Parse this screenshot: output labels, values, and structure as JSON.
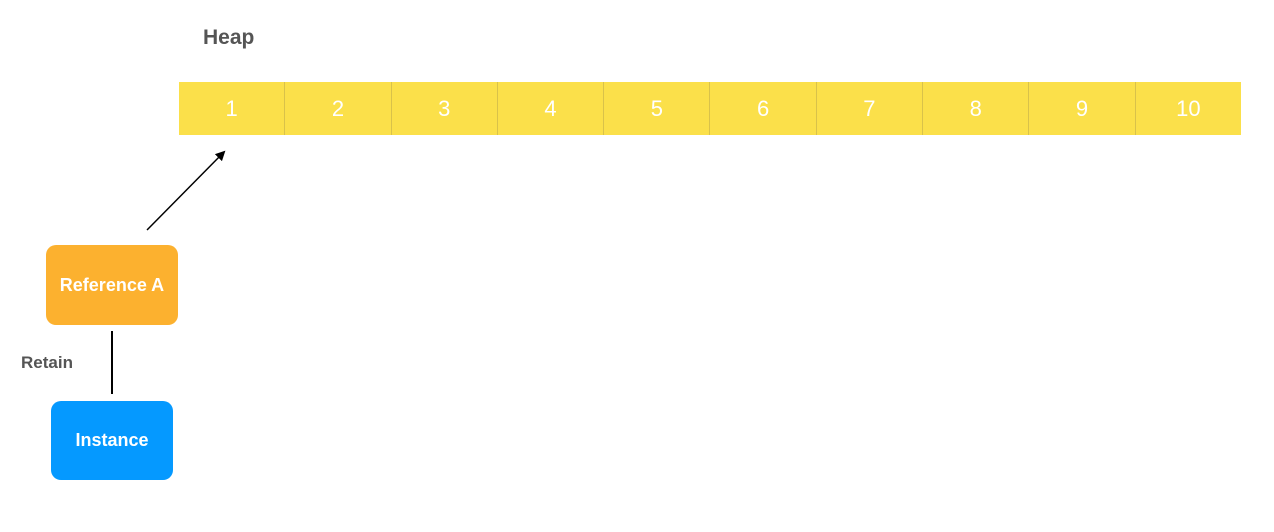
{
  "heap": {
    "title": "Heap",
    "cells": [
      "1",
      "2",
      "3",
      "4",
      "5",
      "6",
      "7",
      "8",
      "9",
      "10"
    ],
    "fill_color": "#fbe04a"
  },
  "reference": {
    "label": "Reference A",
    "color": "#fcb12f"
  },
  "instance": {
    "label": "Instance",
    "color": "#0599ff"
  },
  "relation": {
    "label": "Retain"
  }
}
